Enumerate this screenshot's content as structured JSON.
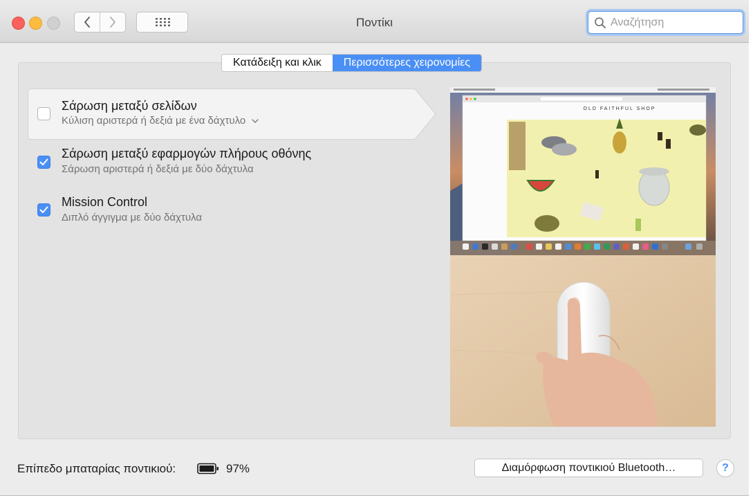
{
  "window": {
    "title": "Ποντίκι",
    "controls": [
      "close",
      "minimize",
      "zoom"
    ]
  },
  "toolbar": {
    "back_icon": "chevron-left-icon",
    "forward_icon": "chevron-right-icon",
    "show_all_icon": "grid-icon"
  },
  "search": {
    "placeholder": "Αναζήτηση",
    "value": ""
  },
  "tabs": [
    {
      "label": "Κατάδειξη και κλικ",
      "active": false
    },
    {
      "label": "Περισσότερες χειρονομίες",
      "active": true
    }
  ],
  "gestures": [
    {
      "title": "Σάρωση μεταξύ σελίδων",
      "subtitle": "Κύλιση αριστερά ή δεξιά με ένα δάχτυλο",
      "checked": false,
      "has_dropdown": true,
      "selected": true
    },
    {
      "title": "Σάρωση μεταξύ εφαρμογών πλήρους οθόνης",
      "subtitle": "Σάρωση αριστερά ή δεξιά με δύο δάχτυλα",
      "checked": true,
      "has_dropdown": false,
      "selected": false
    },
    {
      "title": "Mission Control",
      "subtitle": "Διπλό άγγιγμα με δύο δάχτυλα",
      "checked": true,
      "has_dropdown": false,
      "selected": false
    }
  ],
  "preview": {
    "shop_name": "OLD FAITHFUL SHOP"
  },
  "footer": {
    "battery_label": "Επίπεδο μπαταρίας ποντικιού:",
    "battery_percent": "97%",
    "battery_level": 0.97,
    "bluetooth_button": "Διαμόρφωση ποντικιού Bluetooth…",
    "help_label": "?"
  },
  "colors": {
    "accent": "#4a8ff5",
    "close": "#fc605c",
    "minimize": "#fdbc40",
    "zoom_disabled": "#d0d0d0"
  }
}
